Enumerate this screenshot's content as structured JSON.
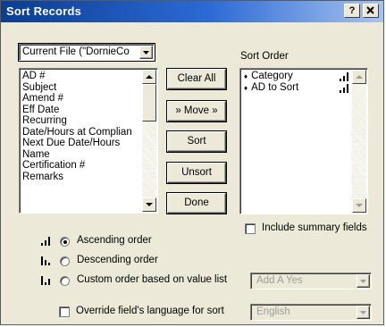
{
  "window": {
    "title": "Sort Records",
    "help_label": "?",
    "close_label": "x"
  },
  "source_dropdown": {
    "value": "Current File (\"DornieCo"
  },
  "fields_list": {
    "items": [
      "AD #",
      "Subject",
      "Amend #",
      "Eff Date",
      "Recurring",
      "Date/Hours at Complian",
      "Next Due Date/Hours",
      "Name",
      "Certification #",
      "Remarks"
    ]
  },
  "buttons": {
    "clear_all": "Clear All",
    "move": "» Move »",
    "sort": "Sort",
    "unsort": "Unsort",
    "done": "Done"
  },
  "sort_order": {
    "label": "Sort Order",
    "items": [
      {
        "mark": "♦",
        "name": "Category"
      },
      {
        "mark": "♦",
        "name": "AD to Sort"
      }
    ]
  },
  "include_summary": {
    "label": "Include summary fields",
    "checked": false
  },
  "order_options": [
    {
      "label": "Ascending order",
      "selected": true,
      "icon": "ascending-order-icon"
    },
    {
      "label": "Descending order",
      "selected": false,
      "icon": "descending-order-icon"
    },
    {
      "label": "Custom order based on value list",
      "selected": false,
      "icon": "custom-order-icon"
    }
  ],
  "value_list_dropdown": {
    "value": "Add A Yes",
    "enabled": false
  },
  "override_language": {
    "label": "Override field's language for sort",
    "checked": false
  },
  "language_dropdown": {
    "value": "English",
    "enabled": false
  }
}
